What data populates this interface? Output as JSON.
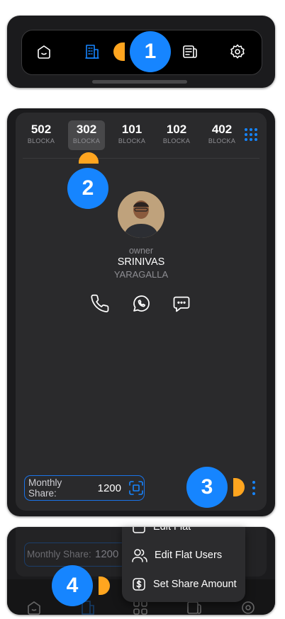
{
  "top_nav": {
    "items": [
      {
        "name": "home",
        "icon": "smile-home-icon"
      },
      {
        "name": "buildings",
        "icon": "building-icon",
        "active": true
      },
      {
        "name": "grid",
        "icon": "grid-icon"
      },
      {
        "name": "news",
        "icon": "newspaper-icon"
      },
      {
        "name": "settings",
        "icon": "gear-icon"
      }
    ]
  },
  "badges": {
    "b1": "1",
    "b2": "2",
    "b3": "3",
    "b4": "4"
  },
  "flats": [
    {
      "number": "502",
      "block": "BLOCKA"
    },
    {
      "number": "302",
      "block": "BLOCKA",
      "selected": true
    },
    {
      "number": "101",
      "block": "BLOCKA"
    },
    {
      "number": "102",
      "block": "BLOCKA"
    },
    {
      "number": "402",
      "block": "BLOCKA"
    }
  ],
  "owner": {
    "role": "owner",
    "first_name": "SRINIVAS",
    "last_name": "YARAGALLA"
  },
  "share": {
    "label": "Monthly Share:",
    "amount": "1200"
  },
  "menu": {
    "items": [
      {
        "label": "Edit Flat",
        "icon": "edit-icon"
      },
      {
        "label": "Edit Flat Users",
        "icon": "users-icon"
      },
      {
        "label": "Set Share Amount",
        "icon": "dollar-box-icon"
      }
    ]
  },
  "colors": {
    "accent": "#1685ff",
    "pointer": "#ffa51f",
    "panel": "#1b1b1d",
    "card": "#2a2a2c"
  }
}
